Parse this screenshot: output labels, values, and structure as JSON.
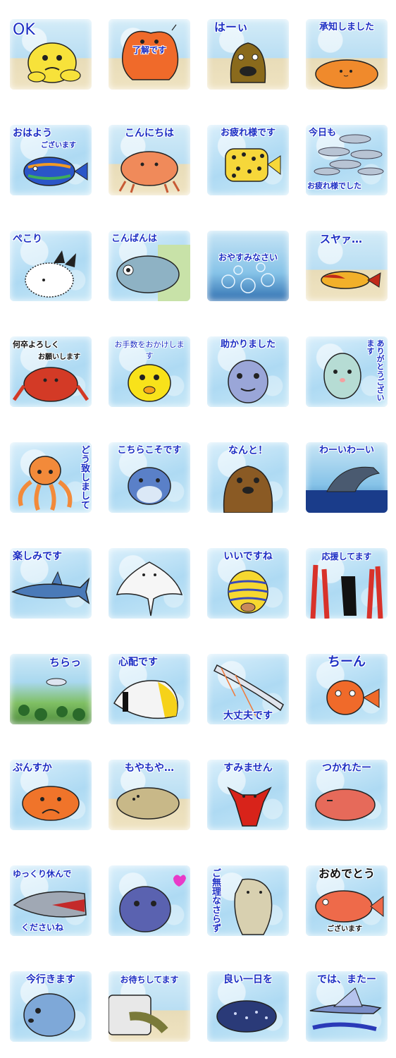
{
  "stickers": [
    {
      "caption": "OK",
      "subject": "yellow-frogfish-icon"
    },
    {
      "caption": "了解です",
      "subject": "orange-frogfish-icon"
    },
    {
      "caption": "はーぃ",
      "subject": "moray-eel-icon"
    },
    {
      "caption": "承知しました",
      "subject": "orange-flatfish-icon"
    },
    {
      "caption": "おはよう",
      "sub": "ございます",
      "subject": "mandarinfish-icon"
    },
    {
      "caption": "こんにちは",
      "subject": "crab-icon"
    },
    {
      "caption": "お疲れ様です",
      "subject": "boxfish-icon"
    },
    {
      "caption": "今日も",
      "sub": "お疲れ様でした",
      "subject": "sardine-school-icon"
    },
    {
      "caption": "ぺこり",
      "subject": "sea-slug-icon"
    },
    {
      "caption": "こんばんは",
      "subject": "scad-fish-icon"
    },
    {
      "caption": "おやすみなさい",
      "subject": "jellyfish-icon"
    },
    {
      "caption": "スヤァ…",
      "subject": "sleeping-fish-icon"
    },
    {
      "caption": "何卒よろしく",
      "sub": "お願いします",
      "subject": "red-crab-icon"
    },
    {
      "caption": "お手数をおかけします",
      "subject": "yellow-fish-icon"
    },
    {
      "caption": "助かりました",
      "subject": "blue-fish-face-icon"
    },
    {
      "caption": "ありがとうございます",
      "subject": "pufferfish-icon"
    },
    {
      "caption": "どう致しまして",
      "subject": "octopus-icon"
    },
    {
      "caption": "こちらこそです",
      "subject": "dolphin-icon"
    },
    {
      "caption": "なんと！",
      "subject": "sea-lion-icon"
    },
    {
      "caption": "わーいわーい",
      "subject": "whale-icon"
    },
    {
      "caption": "楽しみです",
      "subject": "shark-icon"
    },
    {
      "caption": "",
      "subject": "stingray-icon"
    },
    {
      "caption": "いいですね",
      "subject": "sweetlips-icon"
    },
    {
      "caption": "応援してます",
      "subject": "coral-icon"
    },
    {
      "caption": "ちらっ",
      "subject": "reef-fish-icon"
    },
    {
      "caption": "心配です",
      "subject": "butterflyfish-icon"
    },
    {
      "caption": "大丈夫です",
      "subject": "oarfish-icon"
    },
    {
      "caption": "ちーん",
      "subject": "red-goldfish-icon"
    },
    {
      "caption": "ぷんすか",
      "subject": "blobfish-icon"
    },
    {
      "caption": "もやもや…",
      "subject": "flounder-icon"
    },
    {
      "caption": "すみません",
      "subject": "lobster-icon"
    },
    {
      "caption": "つかれたー",
      "subject": "tired-fish-icon"
    },
    {
      "caption": "ゆっくり休んで",
      "sub": "くださいね",
      "subject": "shark-teeth-icon"
    },
    {
      "caption": "",
      "subject": "purple-fish-heart-icon"
    },
    {
      "caption": "ご無理なさらず",
      "subject": "manatee-icon"
    },
    {
      "caption": "おめでとう",
      "sub": "ございます",
      "subject": "sea-bream-icon"
    },
    {
      "caption": "今行きます",
      "subject": "sunfish-icon"
    },
    {
      "caption": "お待ちしてます",
      "subject": "eel-in-pipe-icon"
    },
    {
      "caption": "良い一日を",
      "subject": "coelacanth-icon"
    },
    {
      "caption": "では、またー",
      "subject": "flying-fish-icon"
    }
  ]
}
